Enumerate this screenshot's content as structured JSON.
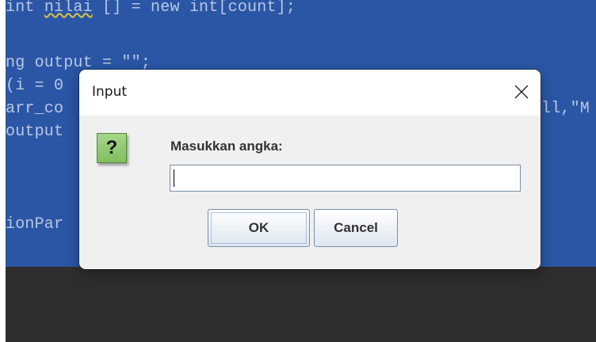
{
  "background_code": {
    "line1": "int nilai [] = new int[count];",
    "line2": "ng output = \"\";",
    "line3": "(i = 0",
    "line4": "arr_co",
    "line4_right": "ll,\"M",
    "line5": "output",
    "line6": "ionPar"
  },
  "dialog": {
    "title": "Input",
    "message": "Masukkan angka:",
    "input_value": "",
    "ok_label": "OK",
    "cancel_label": "Cancel",
    "icon_glyph": "?"
  },
  "colors": {
    "editor_bg": "#2b56a6",
    "dark_panel": "#2e2e2e",
    "dialog_bg": "#f0f0f0",
    "icon_green": "#7fbf5d"
  }
}
